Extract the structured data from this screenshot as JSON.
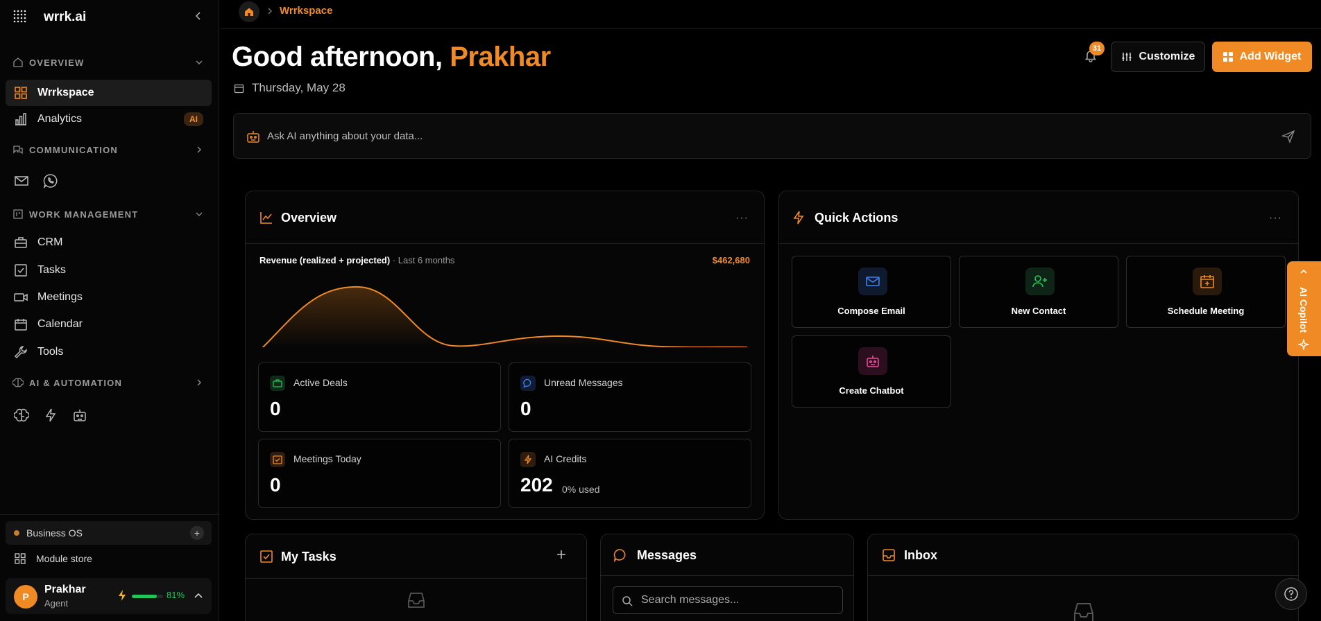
{
  "app": {
    "name": "wrrk.ai"
  },
  "sidebar": {
    "sections": {
      "overview": "OVERVIEW",
      "communication": "COMMUNICATION",
      "work_management": "WORK MANAGEMENT",
      "ai_automation": "AI & AUTOMATION"
    },
    "items": {
      "wrrkspace": "Wrrkspace",
      "analytics": "Analytics",
      "analytics_badge": "AI",
      "crm": "CRM",
      "tasks": "Tasks",
      "meetings": "Meetings",
      "calendar": "Calendar",
      "tools": "Tools"
    },
    "communication_icons": [
      "mail-icon",
      "whatsapp-icon"
    ],
    "automation_icons": [
      "brain-icon",
      "bolt-icon",
      "robot-icon"
    ],
    "business_os": "Business OS",
    "module_store": "Module store",
    "user": {
      "initial": "P",
      "name": "Prakhar",
      "role": "Agent",
      "energy": "81%",
      "energy_fraction": 0.81
    }
  },
  "breadcrumb": {
    "current": "Wrrkspace"
  },
  "header": {
    "greeting": "Good afternoon, ",
    "name": "Prakhar",
    "date": "Thursday, May 28",
    "notification_count": "31",
    "customize_label": "Customize",
    "add_widget_label": "Add Widget"
  },
  "ask": {
    "placeholder": "Ask AI anything about your data..."
  },
  "overview": {
    "title": "Overview",
    "more": "···",
    "revenue_label": "Revenue (realized + projected)",
    "revenue_period": "· Last 6 months",
    "revenue_total": "$462,680",
    "stats": [
      {
        "label": "Active Deals",
        "value": "0",
        "extra": "",
        "color": "#22c55e"
      },
      {
        "label": "Unread Messages",
        "value": "0",
        "extra": "",
        "color": "#3b82f6"
      },
      {
        "label": "Meetings Today",
        "value": "0",
        "extra": "",
        "color": "#f08a24"
      },
      {
        "label": "AI Credits",
        "value": "202",
        "extra": "0% used",
        "color": "#f08a24"
      }
    ]
  },
  "quick_actions": {
    "title": "Quick Actions",
    "more": "···",
    "items": [
      {
        "label": "Compose Email",
        "icon": "mail-icon",
        "color": "#3b82f6"
      },
      {
        "label": "New Contact",
        "icon": "user-plus-icon",
        "color": "#22c55e"
      },
      {
        "label": "Schedule Meeting",
        "icon": "calendar-plus-icon",
        "color": "#f08a24"
      },
      {
        "label": "Create Chatbot",
        "icon": "robot-icon",
        "color": "#ec4899"
      }
    ]
  },
  "my_tasks": {
    "title": "My Tasks",
    "add": "+"
  },
  "messages": {
    "title": "Messages",
    "search_placeholder": "Search messages..."
  },
  "inbox": {
    "title": "Inbox"
  },
  "copilot": {
    "label": "AI Copilot"
  },
  "colors": {
    "accent": "#f08a24",
    "success": "#22c55e"
  }
}
